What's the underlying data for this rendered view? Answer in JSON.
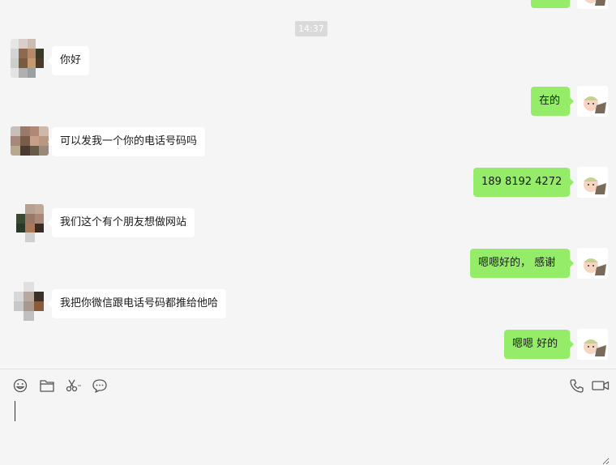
{
  "timestamp": "14:37",
  "messages": [
    {
      "side": "right",
      "text": ""
    },
    {
      "side": "left",
      "text": "你好"
    },
    {
      "side": "right",
      "text": "在的"
    },
    {
      "side": "left",
      "text": "可以发我一个你的电话号码吗"
    },
    {
      "side": "right",
      "text": "189 8192 4272"
    },
    {
      "side": "left",
      "text": "我们这个有个朋友想做网站"
    },
    {
      "side": "right",
      "text": "嗯嗯好的， 感谢"
    },
    {
      "side": "left",
      "text": "我把你微信跟电话号码都推给他哈"
    },
    {
      "side": "right",
      "text": "嗯嗯 好的"
    }
  ],
  "toolbar": {
    "left_icons": [
      "emoji-icon",
      "folder-icon",
      "scissors-icon",
      "chat-bubble-icon"
    ],
    "right_icons": [
      "phone-icon",
      "video-call-icon"
    ]
  },
  "input": {
    "value": ""
  },
  "colors": {
    "background": "#f5f5f5",
    "sent_bubble": "#95ec69",
    "received_bubble": "#ffffff",
    "timestamp_bg": "#dadada"
  }
}
